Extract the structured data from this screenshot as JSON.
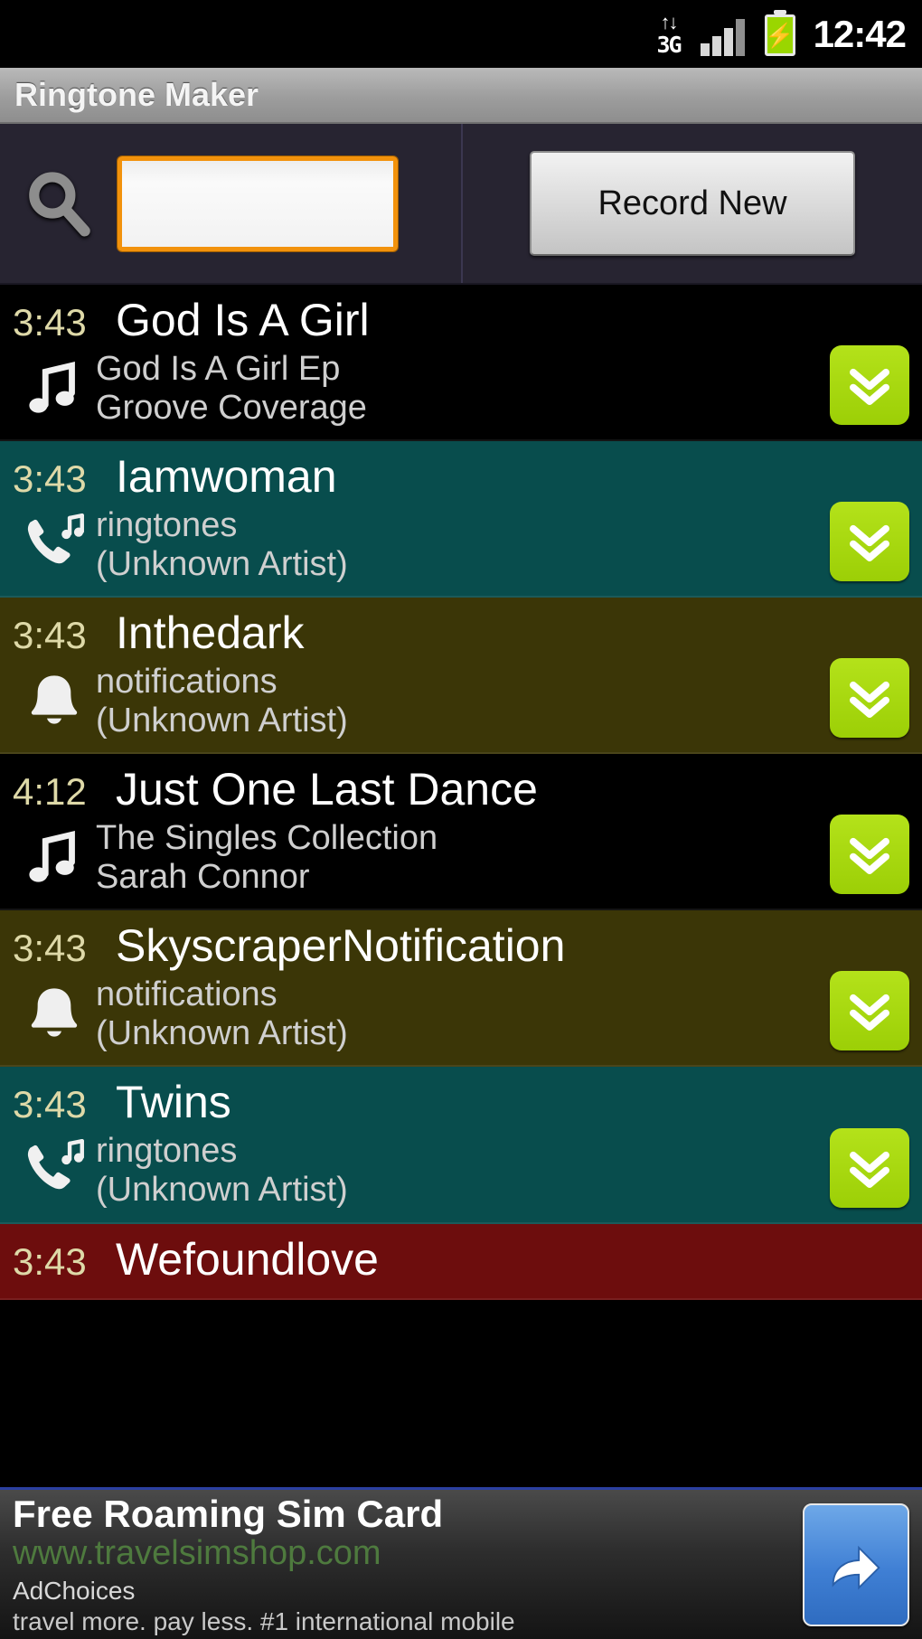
{
  "status_bar": {
    "network_label": "3G",
    "network_arrows": "↑↓",
    "time": "12:42",
    "battery_icon": "battery-charging-icon",
    "signal_icon": "signal-bars-icon"
  },
  "app": {
    "title": "Ringtone Maker"
  },
  "search": {
    "icon": "search-icon",
    "value": "",
    "placeholder": "",
    "record_button_label": "Record New"
  },
  "list": {
    "items": [
      {
        "duration": "3:43",
        "title": "God Is A Girl",
        "album": "God Is A Girl Ep",
        "artist": "Groove Coverage",
        "icon": "music-note-icon",
        "row_color": "#000000",
        "theme": "bg-black",
        "action_icon": "double-chevron-down-icon"
      },
      {
        "duration": "3:43",
        "title": "Iamwoman",
        "album": "ringtones",
        "artist": "(Unknown Artist)",
        "icon": "phone-ringtone-icon",
        "row_color": "#084d4d",
        "theme": "bg-teal",
        "action_icon": "double-chevron-down-icon"
      },
      {
        "duration": "3:43",
        "title": "Inthedark",
        "album": "notifications",
        "artist": "(Unknown Artist)",
        "icon": "bell-notification-icon",
        "row_color": "#3b3607",
        "theme": "bg-olive",
        "action_icon": "double-chevron-down-icon"
      },
      {
        "duration": "4:12",
        "title": "Just One Last Dance",
        "album": "The Singles Collection",
        "artist": "Sarah Connor",
        "icon": "music-note-icon",
        "row_color": "#000000",
        "theme": "bg-black",
        "action_icon": "double-chevron-down-icon"
      },
      {
        "duration": "3:43",
        "title": "SkyscraperNotification",
        "album": "notifications",
        "artist": "(Unknown Artist)",
        "icon": "bell-notification-icon",
        "row_color": "#3b3607",
        "theme": "bg-olive",
        "action_icon": "double-chevron-down-icon"
      },
      {
        "duration": "3:43",
        "title": "Twins",
        "album": "ringtones",
        "artist": "(Unknown Artist)",
        "icon": "phone-ringtone-icon",
        "row_color": "#084d4d",
        "theme": "bg-teal",
        "action_icon": "double-chevron-down-icon"
      },
      {
        "duration": "3:43",
        "title": "Wefoundlove",
        "album": "",
        "artist": "",
        "icon": "music-note-icon",
        "row_color": "#6d0d0d",
        "theme": "bg-red",
        "action_icon": "double-chevron-down-icon"
      }
    ]
  },
  "ad": {
    "title": "Free Roaming Sim Card",
    "url": "www.travelsimshop.com",
    "choices_label": "AdChoices",
    "tagline": "travel more. pay less. #1 international mobile",
    "button_icon": "share-arrow-icon"
  },
  "colors": {
    "accent_green": "#a9d80f",
    "input_border_orange": "#f2920c",
    "duration_text": "#ded9a8",
    "ad_url_green": "#4e7a3e",
    "ad_border_blue": "#2b3fa0"
  }
}
